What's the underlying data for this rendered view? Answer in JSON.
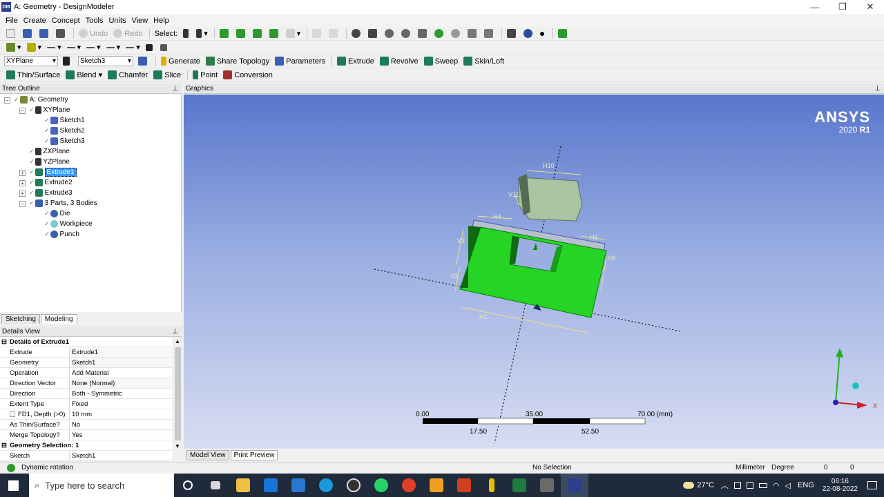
{
  "window": {
    "title": "A: Geometry - DesignModeler",
    "app_icon": "DM",
    "min": "—",
    "max": "❐",
    "close": "✕"
  },
  "menu": [
    "File",
    "Create",
    "Concept",
    "Tools",
    "Units",
    "View",
    "Help"
  ],
  "toolbar1": {
    "undo": "Undo",
    "redo": "Redo",
    "select": "Select:"
  },
  "toolbar3": {
    "plane": "XYPlane",
    "sketch": "Sketch3",
    "generate": "Generate",
    "share_topology": "Share Topology",
    "parameters": "Parameters",
    "extrude": "Extrude",
    "revolve": "Revolve",
    "sweep": "Sweep",
    "skin_loft": "Skin/Loft"
  },
  "toolbar4": {
    "thin_surface": "Thin/Surface",
    "blend": "Blend",
    "chamfer": "Chamfer",
    "slice": "Slice",
    "point": "Point",
    "conversion": "Conversion"
  },
  "tree": {
    "header": "Tree Outline",
    "items": [
      {
        "label": "A: Geometry"
      },
      {
        "label": "XYPlane"
      },
      {
        "label": "Sketch1"
      },
      {
        "label": "Sketch2"
      },
      {
        "label": "Sketch3"
      },
      {
        "label": "ZXPlane"
      },
      {
        "label": "YZPlane"
      },
      {
        "label": "Extrude1"
      },
      {
        "label": "Extrude2"
      },
      {
        "label": "Extrude3"
      },
      {
        "label": "3 Parts, 3 Bodies"
      },
      {
        "label": "Die"
      },
      {
        "label": "Workpiece"
      },
      {
        "label": "Punch"
      }
    ]
  },
  "tabs": {
    "sketching": "Sketching",
    "modeling": "Modeling"
  },
  "details": {
    "header": "Details View",
    "group1": "Details of Extrude1",
    "rows": [
      {
        "k": "Extrude",
        "v": "Extrude1"
      },
      {
        "k": "Geometry",
        "v": "Sketch1"
      },
      {
        "k": "Operation",
        "v": "Add Material"
      },
      {
        "k": "Direction Vector",
        "v": "None (Normal)"
      },
      {
        "k": "Direction",
        "v": "Both - Symmetric"
      },
      {
        "k": "Extent Type",
        "v": "Fixed"
      },
      {
        "k": "FD1, Depth (>0)",
        "v": "10 mm"
      },
      {
        "k": "As Thin/Surface?",
        "v": "No"
      },
      {
        "k": "Merge Topology?",
        "v": "Yes"
      }
    ],
    "group2": "Geometry Selection: 1",
    "last_row": {
      "k": "Sketch",
      "v": "Sketch1"
    }
  },
  "graphics": {
    "header": "Graphics",
    "logo": "ANSYS",
    "version_prefix": "2020",
    "version_suffix": "R1",
    "dims": [
      "H10",
      "V11",
      "H4",
      "H5",
      "V3",
      "V2",
      "V6",
      "H1"
    ],
    "scale": {
      "top": [
        "0.00",
        "35.00",
        "70.00 (mm)"
      ],
      "bottom": [
        "17.50",
        "52.50"
      ]
    },
    "axis_x": "X",
    "axis_y": "Y"
  },
  "graphics_tabs": {
    "model_view": "Model View",
    "print_preview": "Print Preview"
  },
  "status": {
    "mode": "Dynamic rotation",
    "selection": "No Selection",
    "units": "Millimeter",
    "angle": "Degree",
    "v1": "0",
    "v2": "0"
  },
  "taskbar": {
    "search": "Type here to search",
    "temp": "27°C",
    "lang": "ENG",
    "time": "06:16",
    "date": "22-08-2022"
  },
  "colors": {
    "body_green": "#26d426",
    "graphics_top": "#5876cc",
    "graphics_bottom": "#d8ddf2",
    "selection": "#3399ff"
  }
}
